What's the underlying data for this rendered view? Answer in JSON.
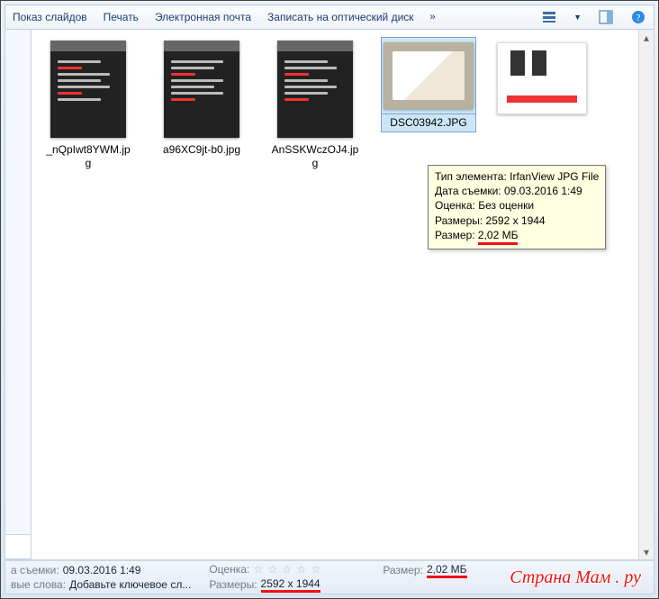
{
  "toolbar": {
    "slideshow": "Показ слайдов",
    "print": "Печать",
    "email": "Электронная почта",
    "burn": "Записать на оптический диск",
    "overflow": "»"
  },
  "files": [
    {
      "name": "_nQpIwt8YWM.jpg"
    },
    {
      "name": "a96XC9jt-b0.jpg"
    },
    {
      "name": "AnSSKWczOJ4.jpg"
    },
    {
      "name": "DSC03942.JPG",
      "selected": true
    },
    {
      "name": "",
      "soft": true
    }
  ],
  "tooltip": {
    "type_label": "Тип элемента:",
    "type_value": "IrfanView JPG File",
    "date_label": "Дата съемки:",
    "date_value": "09.03.2016 1:49",
    "rating_label": "Оценка:",
    "rating_value": "Без оценки",
    "dims_label": "Размеры:",
    "dims_value": "2592 x 1944",
    "size_label": "Размер:",
    "size_value": "2,02 МБ"
  },
  "status": {
    "date_label": "а съемки:",
    "date_value": "09.03.2016 1:49",
    "tags_label": "вые слова:",
    "tags_value": "Добавьте ключевое сл...",
    "rating_label": "Оценка:",
    "dims_label": "Размеры:",
    "dims_value": "2592 x 1944",
    "size_label": "Размер:",
    "size_value": "2,02 МБ"
  },
  "watermark": "Страна Мам . ру"
}
